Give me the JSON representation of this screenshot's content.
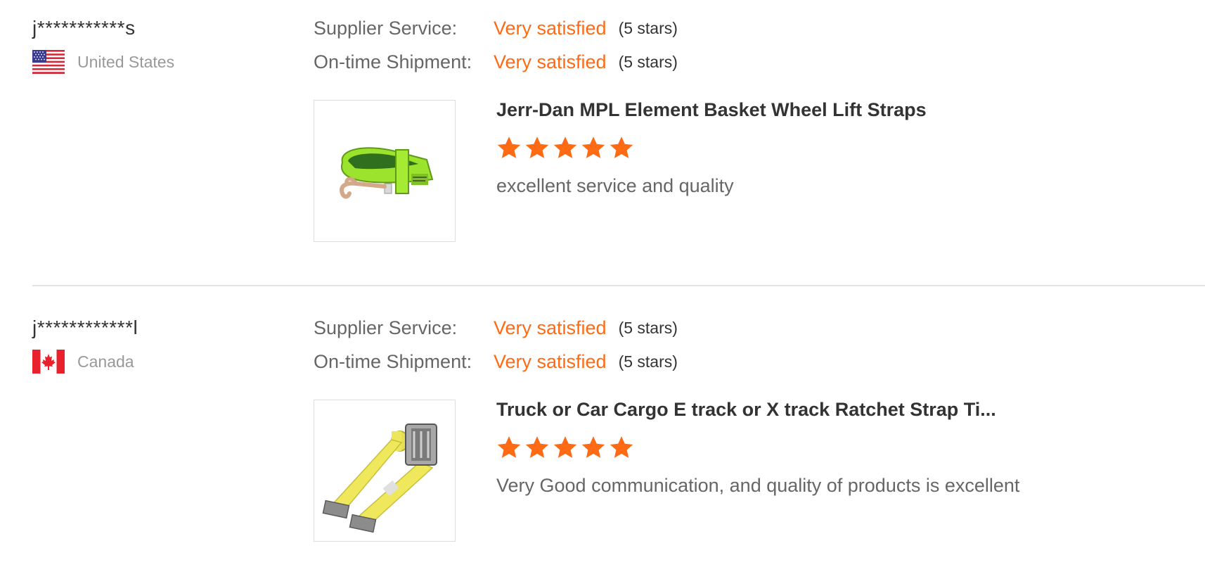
{
  "reviews": [
    {
      "buyer_name": "j***********s",
      "country": "United States",
      "flag_icon": "us-flag-icon",
      "supplier_service_label": "Supplier Service:",
      "supplier_service_value": "Very satisfied",
      "supplier_service_stars": "(5 stars)",
      "shipment_label": "On-time Shipment:",
      "shipment_value": "Very satisfied",
      "shipment_stars": "(5 stars)",
      "product_title": "Jerr-Dan MPL Element Basket Wheel Lift Straps",
      "product_rating": 5,
      "review_text": "excellent service and quality",
      "thumbnail_icon": "green-wheel-lift-strap-image"
    },
    {
      "buyer_name": "j************l",
      "country": "Canada",
      "flag_icon": "canada-flag-icon",
      "supplier_service_label": "Supplier Service:",
      "supplier_service_value": "Very satisfied",
      "supplier_service_stars": "(5 stars)",
      "shipment_label": "On-time Shipment:",
      "shipment_value": "Very satisfied",
      "shipment_stars": "(5 stars)",
      "product_title": "Truck or Car Cargo E track or X track Ratchet Strap Ti...",
      "product_rating": 5,
      "review_text": "Very Good communication, and quality of products is excellent",
      "thumbnail_icon": "yellow-ratchet-strap-image"
    }
  ],
  "colors": {
    "accent": "#ff6a14",
    "text_dark": "#333333",
    "text_muted": "#666666",
    "text_light": "#999999",
    "divider": "#e3e3e3"
  }
}
